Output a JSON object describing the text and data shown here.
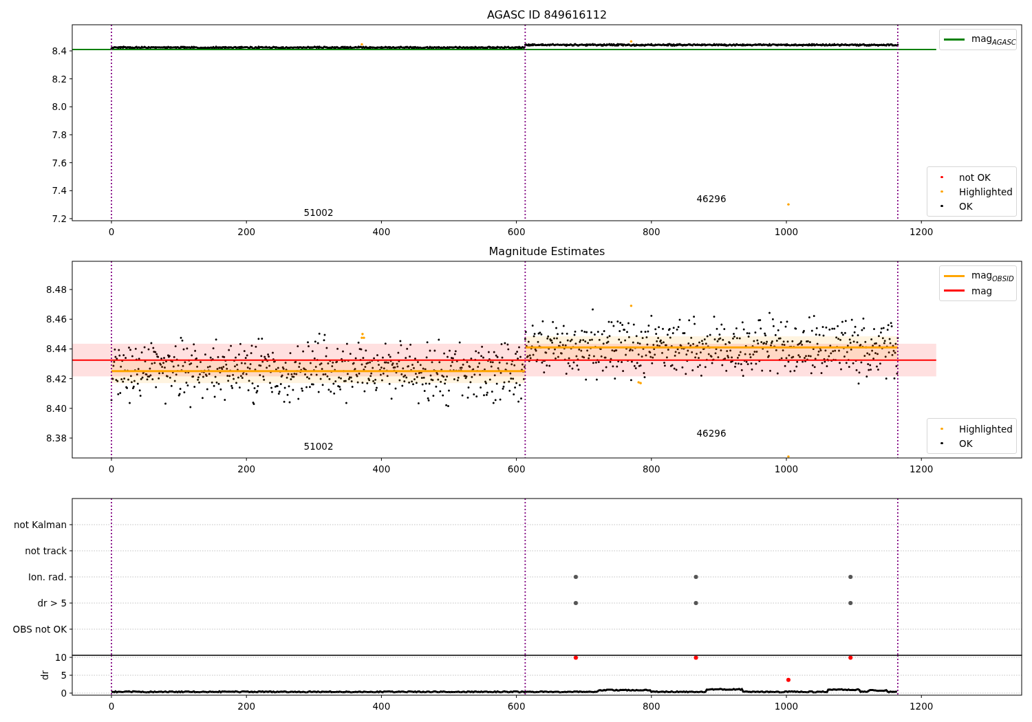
{
  "panels": [
    {
      "title": "AGASC ID 849616112",
      "kind": "tight",
      "chart_data": {
        "type": "line",
        "xlim": [
          -58.1,
          1348.6
        ],
        "ylim": [
          7.185,
          8.587
        ],
        "xticks": [
          0,
          200,
          400,
          600,
          800,
          1000,
          1200
        ],
        "yticks": [
          {
            "value": 7.2,
            "label": "7.2"
          },
          {
            "value": 7.4,
            "label": "7.4"
          },
          {
            "value": 7.6,
            "label": "7.6"
          },
          {
            "value": 7.8,
            "label": "7.8"
          },
          {
            "value": 8.0,
            "label": "8.0"
          },
          {
            "value": 8.2,
            "label": "8.2"
          },
          {
            "value": 8.4,
            "label": "8.4"
          }
        ],
        "ref_lines": [
          {
            "axis": "x",
            "value": 0,
            "color": "#800080"
          },
          {
            "axis": "x",
            "value": 613,
            "color": "#800080"
          },
          {
            "axis": "x",
            "value": 1165,
            "color": "#800080"
          }
        ],
        "series": [
          {
            "color": "#008000",
            "x": [
              -58.1,
              1222
            ],
            "values": [
              8.41,
              8.41
            ]
          }
        ],
        "annotations": [
          "51002",
          "46296"
        ]
      },
      "legends": [
        {
          "entries": [
            {
              "kind": "line",
              "color": "#008000",
              "label": "mag$_{AGASC}$"
            }
          ]
        },
        {
          "entries": [
            {
              "kind": "dot",
              "color": "#ff0000",
              "label": "not OK"
            },
            {
              "kind": "dot",
              "color": "#ffa500",
              "label": "Highlighted"
            },
            {
              "kind": "dot",
              "color": "#000000",
              "label": "OK"
            }
          ]
        }
      ]
    },
    {
      "title": "Magnitude Estimates",
      "kind": "wide",
      "chart_data": {
        "type": "line",
        "xlim": [
          -58.1,
          1348.6
        ],
        "ylim": [
          8.3666,
          8.499
        ],
        "xticks": [
          0,
          200,
          400,
          600,
          800,
          1000,
          1200
        ],
        "yticks": [
          {
            "value": 8.38,
            "label": "8.38"
          },
          {
            "value": 8.4,
            "label": "8.40"
          },
          {
            "value": 8.42,
            "label": "8.42"
          },
          {
            "value": 8.44,
            "label": "8.44"
          },
          {
            "value": 8.46,
            "label": "8.46"
          },
          {
            "value": 8.48,
            "label": "8.48"
          }
        ],
        "ref_lines": [
          {
            "axis": "x",
            "value": 0,
            "color": "#800080"
          },
          {
            "axis": "x",
            "value": 613,
            "color": "#800080"
          },
          {
            "axis": "x",
            "value": 1165,
            "color": "#800080"
          }
        ],
        "bands": [
          {
            "axis": "y",
            "from": 8.4215,
            "to": 8.4435,
            "color": "#ff0000"
          },
          {
            "axis": "y",
            "from": 8.417,
            "to": 8.433,
            "color": "#ffa500"
          },
          {
            "axis": "y",
            "from": 8.433,
            "to": 8.4485,
            "color": "#ffa500"
          }
        ],
        "series": [
          {
            "color": "#ffa500",
            "x": [
              0,
              613
            ],
            "values": [
              8.425,
              8.425
            ]
          },
          {
            "color": "#ffa500",
            "x": [
              613,
              1165
            ],
            "values": [
              8.441,
              8.441
            ]
          },
          {
            "color": "#ff0000",
            "x": [
              -58.1,
              1222
            ],
            "values": [
              8.4325,
              8.4325
            ]
          }
        ],
        "annotations": [
          "51002",
          "46296"
        ]
      },
      "legends": [
        {
          "entries": [
            {
              "kind": "line",
              "color": "#ffa500",
              "label": "mag$_{OBSID}$"
            },
            {
              "kind": "line",
              "color": "#ff0000",
              "label": "mag"
            }
          ]
        },
        {
          "entries": [
            {
              "kind": "dot",
              "color": "#ffa500",
              "label": "Highlighted"
            },
            {
              "kind": "dot",
              "color": "#000000",
              "label": "OK"
            }
          ]
        }
      ]
    },
    {
      "kind": "flags",
      "chart_data": {
        "type": "scatter",
        "orientation": "horizontal",
        "grid": true,
        "xlim": [
          -58.1,
          1348.6
        ],
        "categories": [
          "not Kalman",
          "not track",
          "Ion. rad.",
          "dr > 5",
          "OBS not OK"
        ],
        "ref_lines": [
          {
            "axis": "x",
            "value": 0,
            "color": "#800080"
          },
          {
            "axis": "x",
            "value": 613,
            "color": "#800080"
          },
          {
            "axis": "x",
            "value": 1165,
            "color": "#800080"
          }
        ],
        "series": [
          {
            "color": "#555555",
            "values": [
              null,
              null,
              688,
              688,
              null
            ]
          },
          {
            "color": "#555555",
            "values": [
              null,
              null,
              866,
              866,
              null
            ]
          },
          {
            "color": "#555555",
            "values": [
              null,
              null,
              1095,
              1095,
              null
            ]
          }
        ]
      }
    },
    {
      "kind": "dr",
      "chart_data": {
        "type": "scatter",
        "grid": true,
        "ylabel": "dr",
        "xlim": [
          -58.1,
          1348.6
        ],
        "ylim": [
          -0.58,
          10.58
        ],
        "xticks": [
          0,
          200,
          400,
          600,
          800,
          1000,
          1200
        ],
        "yticks": [
          {
            "value": 0,
            "label": "0"
          },
          {
            "value": 5,
            "label": "5"
          },
          {
            "value": 10,
            "label": "10"
          }
        ],
        "ref_lines": [
          {
            "axis": "x",
            "value": 0,
            "color": "#800080"
          },
          {
            "axis": "x",
            "value": 613,
            "color": "#800080"
          },
          {
            "axis": "x",
            "value": 1165,
            "color": "#800080"
          }
        ],
        "series": [
          {
            "color": "#ff0000",
            "x": [
              688,
              866,
              1095,
              1003
            ],
            "values": [
              9.9,
              9.9,
              9.9,
              3.7
            ]
          }
        ]
      }
    }
  ]
}
